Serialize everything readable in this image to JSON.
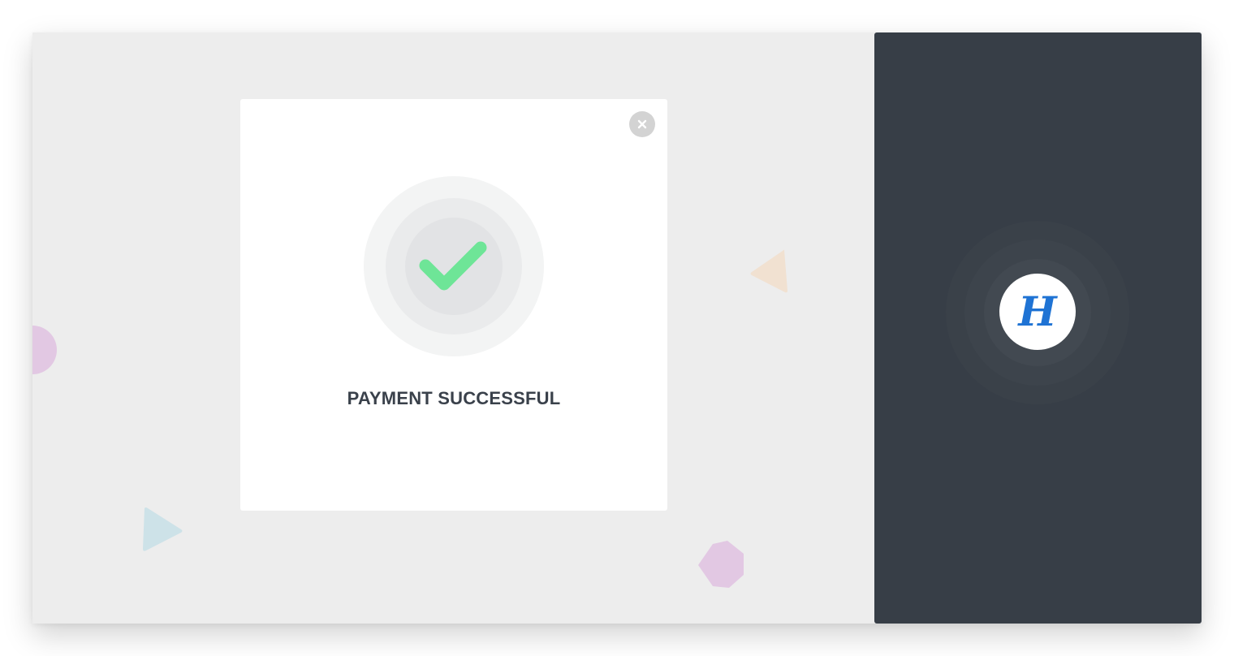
{
  "payment_status": {
    "title": "PAYMENT SUCCESSFUL",
    "status": "success",
    "icon": "checkmark-icon",
    "accent_color": "#6ee597"
  },
  "modal": {
    "close_icon": "close-icon"
  },
  "brand": {
    "logo_letter": "H",
    "logo_color": "#1f73d4",
    "panel_color": "#373e47"
  },
  "background": {
    "color": "#ededed",
    "decorations": [
      {
        "shape": "circle",
        "color": "#e2c8e3"
      },
      {
        "shape": "triangle",
        "color": "#f1e1d1"
      },
      {
        "shape": "triangle",
        "color": "#cde2e8"
      },
      {
        "shape": "hexagon",
        "color": "#e2c8e3"
      }
    ]
  }
}
